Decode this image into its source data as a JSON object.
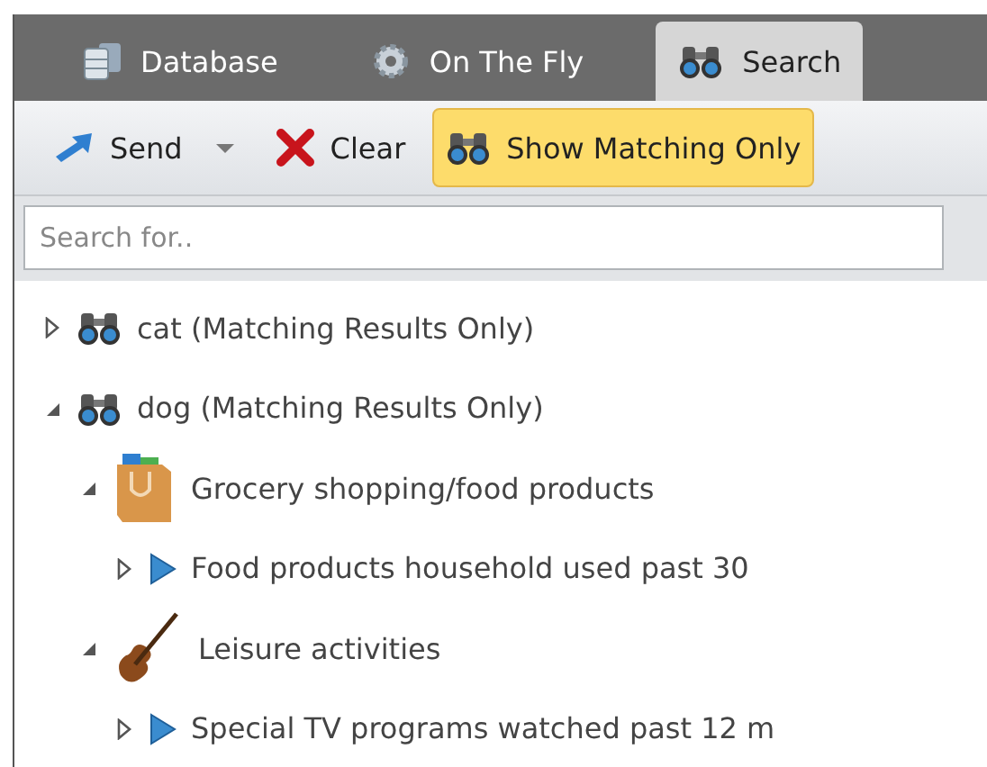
{
  "tabs": [
    {
      "label": "Database",
      "kind": "database",
      "selected": false
    },
    {
      "label": "On The Fly",
      "kind": "gear",
      "selected": false
    },
    {
      "label": "Search",
      "kind": "binoculars",
      "selected": true
    }
  ],
  "toolbar": [
    {
      "label": "Send",
      "kind": "send",
      "dropdown": true,
      "selected": false
    },
    {
      "label": "Clear",
      "kind": "clear",
      "dropdown": false,
      "selected": false
    },
    {
      "label": "Show Matching Only",
      "kind": "matching",
      "dropdown": false,
      "selected": true
    }
  ],
  "search": {
    "placeholder": "Search for.."
  },
  "tree": [
    {
      "label": "cat (Matching Results Only)",
      "kind": "binoculars",
      "expanded": false
    },
    {
      "label": "dog (Matching Results Only)",
      "kind": "binoculars",
      "expanded": true,
      "children": [
        {
          "label": "Grocery shopping/food products",
          "kind": "bag",
          "expanded": true,
          "children": [
            {
              "label": "Food products household used past 30",
              "kind": "question",
              "expanded": false
            }
          ]
        },
        {
          "label": "Leisure activities",
          "kind": "violin",
          "expanded": true,
          "children": [
            {
              "label": "Special TV programs watched past 12 m",
              "kind": "question",
              "expanded": false
            }
          ]
        }
      ]
    }
  ]
}
